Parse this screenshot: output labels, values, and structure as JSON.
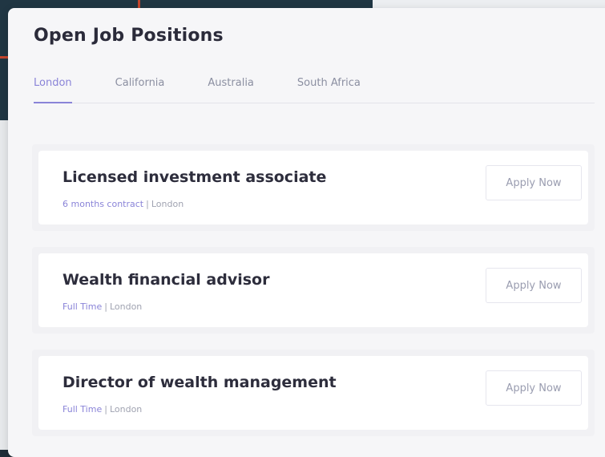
{
  "page": {
    "title": "Open Job Positions"
  },
  "tabs": [
    {
      "label": "London",
      "active": true
    },
    {
      "label": "California",
      "active": false
    },
    {
      "label": "Australia",
      "active": false
    },
    {
      "label": "South Africa",
      "active": false
    }
  ],
  "jobs": [
    {
      "title": "Licensed investment associate",
      "type": "6 months contract",
      "location": "London",
      "button": "Apply Now"
    },
    {
      "title": "Wealth financial advisor",
      "type": "Full Time",
      "location": "London",
      "button": "Apply Now"
    },
    {
      "title": "Director of wealth management",
      "type": "Full Time",
      "location": "London",
      "button": "Apply Now"
    }
  ],
  "colors": {
    "accent": "#8a84d8",
    "title": "#2b2b3a",
    "muted": "#a0a3b1"
  }
}
